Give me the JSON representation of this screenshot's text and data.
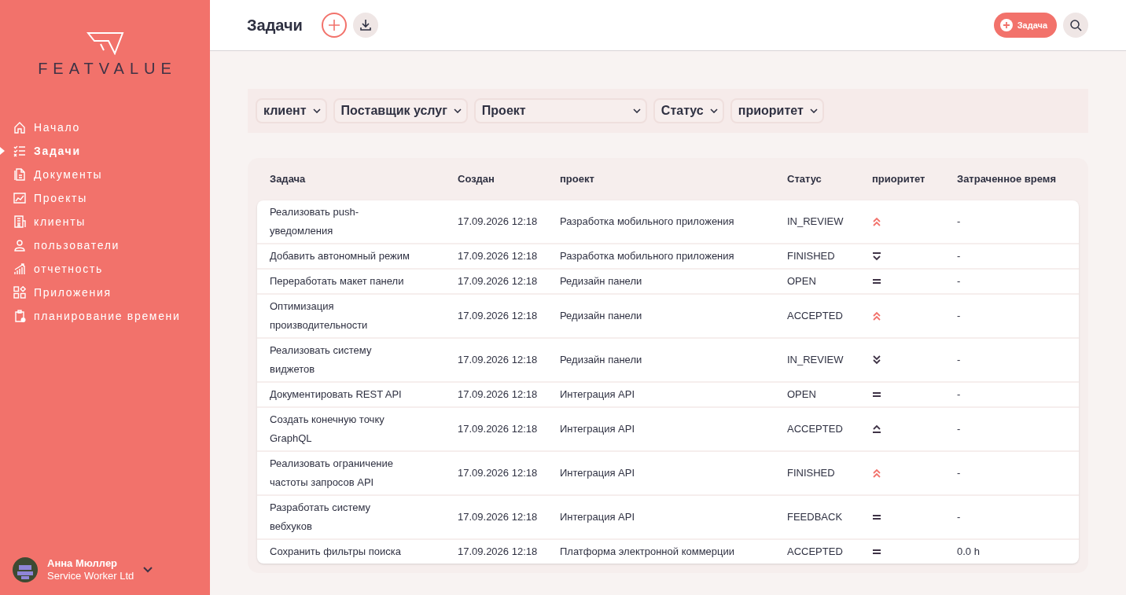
{
  "brand": {
    "name": "FEATVALUE"
  },
  "sidebar": {
    "items": [
      {
        "label": "Начало",
        "selected": false
      },
      {
        "label": "Задачи",
        "selected": true
      },
      {
        "label": "Документы",
        "selected": false
      },
      {
        "label": "Проекты",
        "selected": false
      },
      {
        "label": "клиенты",
        "selected": false
      },
      {
        "label": "пользователи",
        "selected": false
      },
      {
        "label": "отчетность",
        "selected": false
      },
      {
        "label": "Приложения",
        "selected": false
      },
      {
        "label": "планирование времени",
        "selected": false
      }
    ]
  },
  "user": {
    "name": "Анна Мюллер",
    "company": "Service Worker Ltd"
  },
  "header": {
    "title": "Задачи",
    "new_button": "Задача"
  },
  "filters": [
    {
      "label": "клиент",
      "wide": false
    },
    {
      "label": "Поставщик услуг",
      "wide": false
    },
    {
      "label": "Проект",
      "wide": true
    },
    {
      "label": "Статус",
      "wide": false
    },
    {
      "label": "приоритет",
      "wide": false
    }
  ],
  "table": {
    "columns": [
      "Задача",
      "Создан",
      "проект",
      "Статус",
      "приоритет",
      "Затраченное время"
    ],
    "rows": [
      {
        "task": "Реализовать push-уведомления",
        "created": "17.09.2026 12:18",
        "project": "Разработка мобильного приложения",
        "status": "IN_REVIEW",
        "priority": {
          "kind": "highest"
        },
        "time": "-"
      },
      {
        "task": "Добавить автономный режим",
        "created": "17.09.2026 12:18",
        "project": "Разработка мобильного приложения",
        "status": "FINISHED",
        "priority": {
          "kind": "low"
        },
        "time": "-"
      },
      {
        "task": "Переработать макет панели",
        "created": "17.09.2026 12:18",
        "project": "Редизайн панели",
        "status": "OPEN",
        "priority": {
          "kind": "medium"
        },
        "time": "-"
      },
      {
        "task": "Оптимизация производительности",
        "created": "17.09.2026 12:18",
        "project": "Редизайн панели",
        "status": "ACCEPTED",
        "priority": {
          "kind": "highest"
        },
        "time": "-"
      },
      {
        "task": "Реализовать систему виджетов",
        "created": "17.09.2026 12:18",
        "project": "Редизайн панели",
        "status": "IN_REVIEW",
        "priority": {
          "kind": "lowest"
        },
        "time": "-"
      },
      {
        "task": "Документировать REST API",
        "created": "17.09.2026 12:18",
        "project": "Интеграция API",
        "status": "OPEN",
        "priority": {
          "kind": "medium"
        },
        "time": "-"
      },
      {
        "task": "Создать конечную точку GraphQL",
        "created": "17.09.2026 12:18",
        "project": "Интеграция API",
        "status": "ACCEPTED",
        "priority": {
          "kind": "high"
        },
        "time": "-"
      },
      {
        "task": "Реализовать ограничение частоты запросов API",
        "created": "17.09.2026 12:18",
        "project": "Интеграция API",
        "status": "FINISHED",
        "priority": {
          "kind": "highest"
        },
        "time": "-"
      },
      {
        "task": "Разработать систему вебхуков",
        "created": "17.09.2026 12:18",
        "project": "Интеграция API",
        "status": "FEEDBACK",
        "priority": {
          "kind": "medium"
        },
        "time": "-"
      },
      {
        "task": "Сохранить фильтры поиска",
        "created": "17.09.2026 12:18",
        "project": "Платформа электронной коммерции",
        "status": "ACCEPTED",
        "priority": {
          "kind": "medium"
        },
        "time": "0.0 h"
      }
    ]
  }
}
